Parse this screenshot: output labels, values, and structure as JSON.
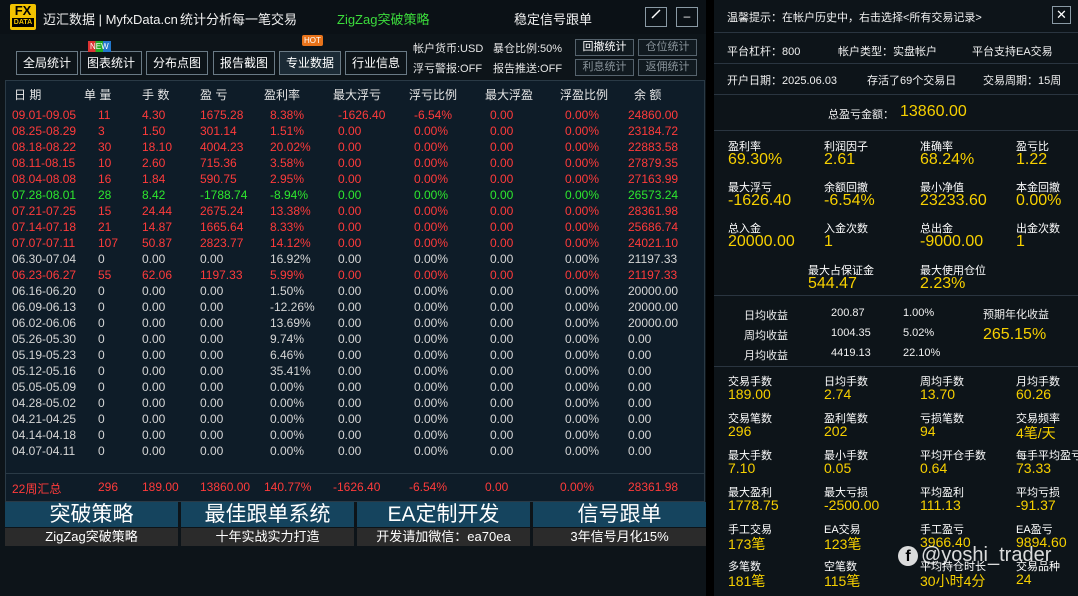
{
  "app": {
    "brand": "迈汇数据 | MyfxData.cn",
    "slogan": "统计分析每一笔交易",
    "strategy": "ZigZag突破策略",
    "signal": "稳定信号跟单",
    "minimize": "–",
    "logo_top": "FX",
    "logo_bottom": "DATA"
  },
  "toolbar": {
    "tabs": [
      {
        "label": "全局统计"
      },
      {
        "label": "图表统计",
        "badge": "NEW"
      },
      {
        "label": "分布点图"
      },
      {
        "label": "报告截图"
      },
      {
        "label": "专业数据",
        "badge": "HOT"
      },
      {
        "label": "行业信息"
      }
    ],
    "currency": "帐户货币:USD",
    "exposure": "暴仓比例:50%",
    "float_alert": "浮亏警报:OFF",
    "report_push": "报告推送:OFF",
    "stat_buttons": [
      "回撤统计",
      "仓位统计",
      "利息统计",
      "返佣统计"
    ]
  },
  "colors": {
    "accent_yellow": "#f7d000",
    "profit_red": "#ff3b3b",
    "loss_green": "#2ee82e",
    "promo_blue": "#15445e"
  },
  "table": {
    "headers": [
      "日 期",
      "单 量",
      "手 数",
      "盈 亏",
      "盈利率",
      "最大浮亏",
      "浮亏比例",
      "最大浮盈",
      "浮盈比例",
      "余 额"
    ],
    "rows": [
      {
        "c": "red",
        "v": [
          "09.01-09.05",
          "11",
          "4.30",
          "1675.28",
          "8.38%",
          "-1626.40",
          "-6.54%",
          "0.00",
          "0.00%",
          "24860.00"
        ]
      },
      {
        "c": "red",
        "v": [
          "08.25-08.29",
          "3",
          "1.50",
          "301.14",
          "1.51%",
          "0.00",
          "0.00%",
          "0.00",
          "0.00%",
          "23184.72"
        ]
      },
      {
        "c": "red",
        "v": [
          "08.18-08.22",
          "30",
          "18.10",
          "4004.23",
          "20.02%",
          "0.00",
          "0.00%",
          "0.00",
          "0.00%",
          "22883.58"
        ]
      },
      {
        "c": "red",
        "v": [
          "08.11-08.15",
          "10",
          "2.60",
          "715.36",
          "3.58%",
          "0.00",
          "0.00%",
          "0.00",
          "0.00%",
          "27879.35"
        ]
      },
      {
        "c": "red",
        "v": [
          "08.04-08.08",
          "16",
          "1.84",
          "590.75",
          "2.95%",
          "0.00",
          "0.00%",
          "0.00",
          "0.00%",
          "27163.99"
        ]
      },
      {
        "c": "green",
        "v": [
          "07.28-08.01",
          "28",
          "8.42",
          "-1788.74",
          "-8.94%",
          "0.00",
          "0.00%",
          "0.00",
          "0.00%",
          "26573.24"
        ]
      },
      {
        "c": "red",
        "v": [
          "07.21-07.25",
          "15",
          "24.44",
          "2675.24",
          "13.38%",
          "0.00",
          "0.00%",
          "0.00",
          "0.00%",
          "28361.98"
        ]
      },
      {
        "c": "red",
        "v": [
          "07.14-07.18",
          "21",
          "14.87",
          "1665.64",
          "8.33%",
          "0.00",
          "0.00%",
          "0.00",
          "0.00%",
          "25686.74"
        ]
      },
      {
        "c": "red",
        "v": [
          "07.07-07.11",
          "107",
          "50.87",
          "2823.77",
          "14.12%",
          "0.00",
          "0.00%",
          "0.00",
          "0.00%",
          "24021.10"
        ]
      },
      {
        "c": "gray",
        "v": [
          "06.30-07.04",
          "0",
          "0.00",
          "0.00",
          "16.92%",
          "0.00",
          "0.00%",
          "0.00",
          "0.00%",
          "21197.33"
        ]
      },
      {
        "c": "red",
        "v": [
          "06.23-06.27",
          "55",
          "62.06",
          "1197.33",
          "5.99%",
          "0.00",
          "0.00%",
          "0.00",
          "0.00%",
          "21197.33"
        ]
      },
      {
        "c": "gray",
        "v": [
          "06.16-06.20",
          "0",
          "0.00",
          "0.00",
          "1.50%",
          "0.00",
          "0.00%",
          "0.00",
          "0.00%",
          "20000.00"
        ]
      },
      {
        "c": "gray",
        "v": [
          "06.09-06.13",
          "0",
          "0.00",
          "0.00",
          "-12.26%",
          "0.00",
          "0.00%",
          "0.00",
          "0.00%",
          "20000.00"
        ]
      },
      {
        "c": "gray",
        "v": [
          "06.02-06.06",
          "0",
          "0.00",
          "0.00",
          "13.69%",
          "0.00",
          "0.00%",
          "0.00",
          "0.00%",
          "20000.00"
        ]
      },
      {
        "c": "gray",
        "v": [
          "05.26-05.30",
          "0",
          "0.00",
          "0.00",
          "9.74%",
          "0.00",
          "0.00%",
          "0.00",
          "0.00%",
          "0.00"
        ]
      },
      {
        "c": "gray",
        "v": [
          "05.19-05.23",
          "0",
          "0.00",
          "0.00",
          "6.46%",
          "0.00",
          "0.00%",
          "0.00",
          "0.00%",
          "0.00"
        ]
      },
      {
        "c": "gray",
        "v": [
          "05.12-05.16",
          "0",
          "0.00",
          "0.00",
          "35.41%",
          "0.00",
          "0.00%",
          "0.00",
          "0.00%",
          "0.00"
        ]
      },
      {
        "c": "gray",
        "v": [
          "05.05-05.09",
          "0",
          "0.00",
          "0.00",
          "0.00%",
          "0.00",
          "0.00%",
          "0.00",
          "0.00%",
          "0.00"
        ]
      },
      {
        "c": "gray",
        "v": [
          "04.28-05.02",
          "0",
          "0.00",
          "0.00",
          "0.00%",
          "0.00",
          "0.00%",
          "0.00",
          "0.00%",
          "0.00"
        ]
      },
      {
        "c": "gray",
        "v": [
          "04.21-04.25",
          "0",
          "0.00",
          "0.00",
          "0.00%",
          "0.00",
          "0.00%",
          "0.00",
          "0.00%",
          "0.00"
        ]
      },
      {
        "c": "gray",
        "v": [
          "04.14-04.18",
          "0",
          "0.00",
          "0.00",
          "0.00%",
          "0.00",
          "0.00%",
          "0.00",
          "0.00%",
          "0.00"
        ]
      },
      {
        "c": "gray",
        "v": [
          "04.07-04.11",
          "0",
          "0.00",
          "0.00",
          "0.00%",
          "0.00",
          "0.00%",
          "0.00",
          "0.00%",
          "0.00"
        ]
      }
    ],
    "summary": [
      "22周汇总",
      "296",
      "189.00",
      "13860.00",
      "140.77%",
      "-1626.40",
      "-6.54%",
      "0.00",
      "0.00%",
      "28361.98"
    ]
  },
  "promos": [
    {
      "title": "突破策略",
      "sub": "ZigZag突破策略"
    },
    {
      "title": "最佳跟单系统",
      "sub": "十年实战实力打造"
    },
    {
      "title": "EA定制开发",
      "sub": "开发请加微信：ea70ea"
    },
    {
      "title": "信号跟单",
      "sub": "3年信号月化15%"
    }
  ],
  "right": {
    "tip": "温馨提示：在帐户历史中，右击选择<所有交易记录>",
    "close": "✕",
    "leverage": "平台杠杆：800",
    "account_type": "帐户类型：实盘帐户",
    "ea_support": "平台支持EA交易",
    "open_date": "开户日期：2025.06.03",
    "survived": "存活了69个交易日",
    "cycle": "交易周期：15周",
    "total_pl_label": "总盈亏金额：",
    "total_pl": "13860.00",
    "grid1": [
      [
        {
          "label": "盈利率",
          "value": "69.30%"
        },
        {
          "label": "利润因子",
          "value": "2.61"
        },
        {
          "label": "准确率",
          "value": "68.24%"
        },
        {
          "label": "盈亏比",
          "value": "1.22"
        }
      ],
      [
        {
          "label": "最大浮亏",
          "value": "-1626.40"
        },
        {
          "label": "余额回撤",
          "value": "-6.54%"
        },
        {
          "label": "最小净值",
          "value": "23233.60"
        },
        {
          "label": "本金回撤",
          "value": "0.00%"
        }
      ],
      [
        {
          "label": "总入金",
          "value": "20000.00"
        },
        {
          "label": "入金次数",
          "value": "1"
        },
        {
          "label": "总出金",
          "value": "-9000.00"
        },
        {
          "label": "出金次数",
          "value": "1"
        }
      ]
    ],
    "margin": [
      {
        "label": "最大占保证金",
        "value": "544.47"
      },
      {
        "label": "最大使用仓位",
        "value": "2.23%"
      }
    ],
    "income": [
      {
        "label": "日均收益",
        "amount": "200.87",
        "pct": "1.00%"
      },
      {
        "label": "周均收益",
        "amount": "1004.35",
        "pct": "5.02%"
      },
      {
        "label": "月均收益",
        "amount": "4419.13",
        "pct": "22.10%"
      }
    ],
    "annual_label": "预期年化收益",
    "annual_value": "265.15%",
    "grid2": [
      [
        {
          "label": "交易手数",
          "value": "189.00"
        },
        {
          "label": "日均手数",
          "value": "2.74"
        },
        {
          "label": "周均手数",
          "value": "13.70"
        },
        {
          "label": "月均手数",
          "value": "60.26"
        }
      ],
      [
        {
          "label": "交易笔数",
          "value": "296"
        },
        {
          "label": "盈利笔数",
          "value": "202"
        },
        {
          "label": "亏损笔数",
          "value": "94"
        },
        {
          "label": "交易频率",
          "value": "4笔/天"
        }
      ],
      [
        {
          "label": "最大手数",
          "value": "7.10"
        },
        {
          "label": "最小手数",
          "value": "0.05"
        },
        {
          "label": "平均开仓手数",
          "value": "0.64"
        },
        {
          "label": "每手平均盈亏",
          "value": "73.33"
        }
      ],
      [
        {
          "label": "最大盈利",
          "value": "1778.75"
        },
        {
          "label": "最大亏损",
          "value": "-2500.00"
        },
        {
          "label": "平均盈利",
          "value": "111.13"
        },
        {
          "label": "平均亏损",
          "value": "-91.37"
        }
      ],
      [
        {
          "label": "手工交易",
          "value": "173笔"
        },
        {
          "label": "EA交易",
          "value": "123笔"
        },
        {
          "label": "手工盈亏",
          "value": "3966.40"
        },
        {
          "label": "EA盈亏",
          "value": "9894.60"
        }
      ],
      [
        {
          "label": "多笔数",
          "value": "181笔"
        },
        {
          "label": "空笔数",
          "value": "115笔"
        },
        {
          "label": "平均持仓时长",
          "value": "30小时4分"
        },
        {
          "label": "交易品种",
          "value": "24"
        }
      ]
    ],
    "watermark": "@yoshi_trader",
    "watermark_icon": "f"
  }
}
